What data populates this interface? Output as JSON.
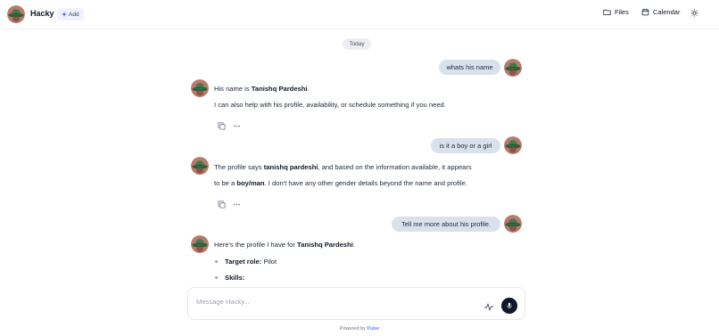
{
  "app": {
    "title": "Hacky",
    "add_label": "Add"
  },
  "header": {
    "files_label": "Files",
    "calendar_label": "Calendar"
  },
  "chat": {
    "date_label": "Today",
    "messages": [
      {
        "role": "user",
        "text": "whats his name"
      },
      {
        "role": "assistant",
        "line1": {
          "pre": "His name is ",
          "bold": "Tanishq Pardeshi",
          "post": "."
        },
        "line2": "I can also help with his profile, availability, or schedule something if you need."
      },
      {
        "role": "user",
        "text": "is it a boy or a girl"
      },
      {
        "role": "assistant",
        "line1": {
          "pre": "The profile says ",
          "bold": "tanishq pardeshi",
          "post": ", and based on the information available, it appears"
        },
        "line2": {
          "pre": "to be a ",
          "bold": "boy/man",
          "post": ". I don't have any other gender details beyond the name and profile."
        }
      },
      {
        "role": "user",
        "text": "Tell me more about his profile."
      },
      {
        "role": "assistant",
        "line1": {
          "pre": "Here's the profile I have for ",
          "bold": "Tanishq Pardeshi",
          "post": ":"
        },
        "bullets": [
          {
            "bold": "Target role:",
            "text": " Pilot"
          },
          {
            "bold": "Skills:",
            "text": ""
          }
        ]
      }
    ]
  },
  "composer": {
    "placeholder": "Message Hacky..."
  },
  "footer": {
    "prefix": "Powered by ",
    "brand": "Pulse"
  },
  "icons": {
    "logo": "hat-avatar-icon",
    "add": "sparkle-icon",
    "files": "folder-icon",
    "calendar": "calendar-icon",
    "theme": "sun-icon",
    "copy": "copy-icon",
    "more": "more-icon",
    "pulse": "pulse-icon",
    "mic": "microphone-icon"
  },
  "colors": {
    "user_bubble": "#d9e2ec",
    "mic_button": "#0f172a",
    "brand_link": "#2563eb"
  }
}
